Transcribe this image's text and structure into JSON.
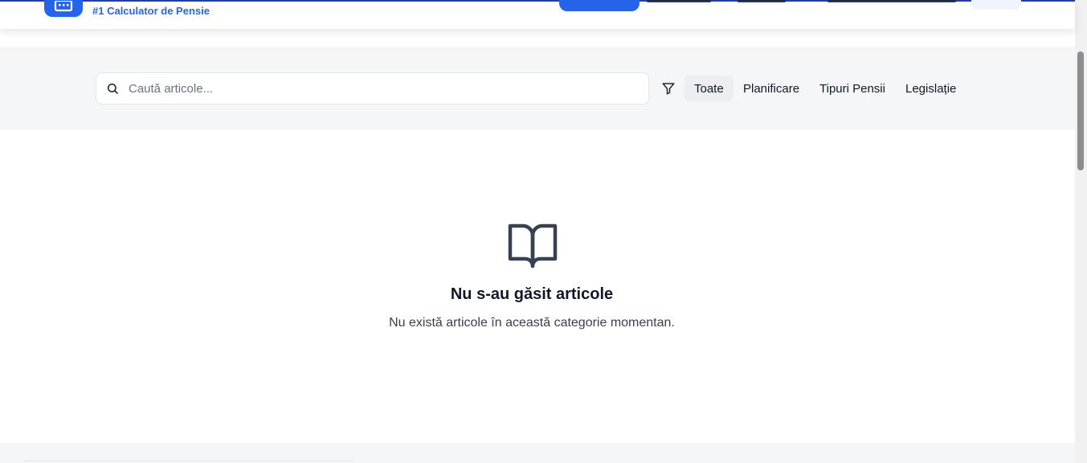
{
  "header": {
    "tagline": "#1 Calculator de Pensie",
    "logo_icon": "calculator-icon",
    "brand_color": "#2563eb"
  },
  "search": {
    "placeholder": "Caută articole...",
    "value": ""
  },
  "filters": {
    "icon": "filter-icon",
    "categories": [
      {
        "label": "Toate",
        "active": true
      },
      {
        "label": "Planificare",
        "active": false
      },
      {
        "label": "Tipuri Pensii",
        "active": false
      },
      {
        "label": "Legislație",
        "active": false
      }
    ]
  },
  "empty_state": {
    "icon": "book-open-icon",
    "title": "Nu s-au găsit articole",
    "subtitle": "Nu există articole în această categorie momentan."
  }
}
